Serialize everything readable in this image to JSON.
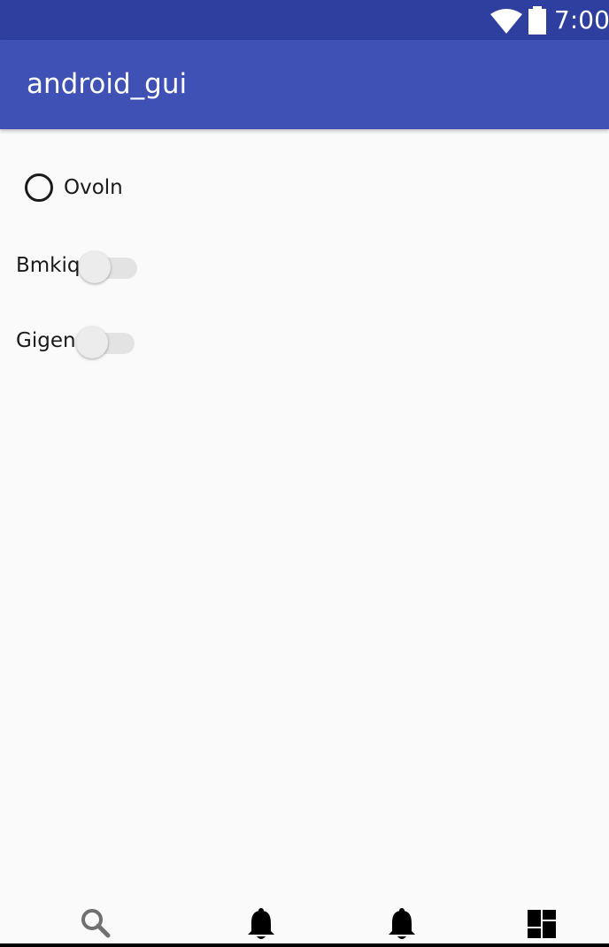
{
  "status_bar": {
    "time": "7:00",
    "icons": [
      "wifi-icon",
      "battery-icon"
    ]
  },
  "app_bar": {
    "title": "android_gui"
  },
  "content": {
    "radio": {
      "label": "Ovoln",
      "checked": false
    },
    "switches": [
      {
        "label": "Bmkiq",
        "on": false
      },
      {
        "label": "Gigen",
        "on": false
      }
    ]
  },
  "bottom_nav": {
    "items": [
      {
        "icon": "search-icon"
      },
      {
        "icon": "bell-icon"
      },
      {
        "icon": "bell-icon"
      },
      {
        "icon": "dashboard-icon"
      }
    ]
  },
  "colors": {
    "status_bar": "#2f3f9f",
    "app_bar": "#3f51b5",
    "background": "#fafafa"
  }
}
